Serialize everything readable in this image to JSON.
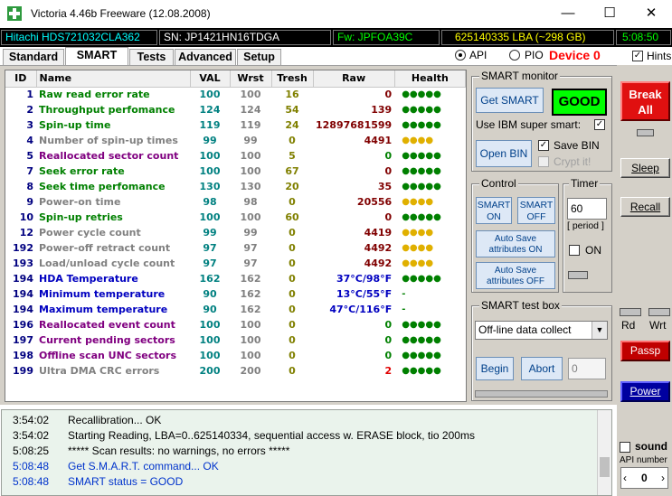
{
  "window": {
    "title": "Victoria 4.46b Freeware (12.08.2008)",
    "minimize": "—",
    "maximize": "☐",
    "close": "✕"
  },
  "drive": {
    "model": "Hitachi HDS721032CLA362",
    "serial": "SN: JP1421HN16TDGA",
    "firmware": "Fw: JPFOA39C",
    "lba": "625140335 LBA (~298 GB)",
    "time": "5:08:50"
  },
  "tabs": [
    {
      "label": "Standard"
    },
    {
      "label": "SMART"
    },
    {
      "label": "Tests"
    },
    {
      "label": "Advanced"
    },
    {
      "label": "Setup"
    }
  ],
  "mode": {
    "api_label": "API",
    "pio_label": "PIO",
    "device_label": "Device 0",
    "hints_label": "Hints"
  },
  "table": {
    "headers": [
      "ID",
      "Name",
      "VAL",
      "Wrst",
      "Tresh",
      "Raw",
      "Health"
    ],
    "rows": [
      {
        "id": "1",
        "name": "Raw read error rate",
        "val": "100",
        "wrst": "100",
        "tresh": "16",
        "raw": "0",
        "health": "●●●●●",
        "name_color": "#008000",
        "raw_color": "#800000",
        "health_color": "#008000"
      },
      {
        "id": "2",
        "name": "Throughput perfomance",
        "val": "124",
        "wrst": "124",
        "tresh": "54",
        "raw": "139",
        "health": "●●●●●",
        "name_color": "#008000",
        "raw_color": "#800000",
        "health_color": "#008000"
      },
      {
        "id": "3",
        "name": "Spin-up time",
        "val": "119",
        "wrst": "119",
        "tresh": "24",
        "raw": "12897681599",
        "health": "●●●●●",
        "name_color": "#008000",
        "raw_color": "#800000",
        "health_color": "#008000"
      },
      {
        "id": "4",
        "name": "Number of spin-up times",
        "val": "99",
        "wrst": "99",
        "tresh": "0",
        "raw": "4491",
        "health": "●●●●",
        "name_color": "#808080",
        "raw_color": "#800000",
        "health_color": "#e0b000"
      },
      {
        "id": "5",
        "name": "Reallocated sector count",
        "val": "100",
        "wrst": "100",
        "tresh": "5",
        "raw": "0",
        "health": "●●●●●",
        "name_color": "#800080",
        "raw_color": "#008000",
        "health_color": "#008000"
      },
      {
        "id": "7",
        "name": "Seek error rate",
        "val": "100",
        "wrst": "100",
        "tresh": "67",
        "raw": "0",
        "health": "●●●●●",
        "name_color": "#008000",
        "raw_color": "#800000",
        "health_color": "#008000"
      },
      {
        "id": "8",
        "name": "Seek time perfomance",
        "val": "130",
        "wrst": "130",
        "tresh": "20",
        "raw": "35",
        "health": "●●●●●",
        "name_color": "#008000",
        "raw_color": "#800000",
        "health_color": "#008000"
      },
      {
        "id": "9",
        "name": "Power-on time",
        "val": "98",
        "wrst": "98",
        "tresh": "0",
        "raw": "20556",
        "health": "●●●●",
        "name_color": "#808080",
        "raw_color": "#800000",
        "health_color": "#e0b000"
      },
      {
        "id": "10",
        "name": "Spin-up retries",
        "val": "100",
        "wrst": "100",
        "tresh": "60",
        "raw": "0",
        "health": "●●●●●",
        "name_color": "#008000",
        "raw_color": "#800000",
        "health_color": "#008000"
      },
      {
        "id": "12",
        "name": "Power cycle count",
        "val": "99",
        "wrst": "99",
        "tresh": "0",
        "raw": "4419",
        "health": "●●●●",
        "name_color": "#808080",
        "raw_color": "#800000",
        "health_color": "#e0b000"
      },
      {
        "id": "192",
        "name": "Power-off retract count",
        "val": "97",
        "wrst": "97",
        "tresh": "0",
        "raw": "4492",
        "health": "●●●●",
        "name_color": "#808080",
        "raw_color": "#800000",
        "health_color": "#e0b000"
      },
      {
        "id": "193",
        "name": "Load/unload cycle count",
        "val": "97",
        "wrst": "97",
        "tresh": "0",
        "raw": "4492",
        "health": "●●●●",
        "name_color": "#808080",
        "raw_color": "#800000",
        "health_color": "#e0b000"
      },
      {
        "id": "194",
        "name": "HDA Temperature",
        "val": "162",
        "wrst": "162",
        "tresh": "0",
        "raw": "37°C/98°F",
        "health": "●●●●●",
        "name_color": "#0000c0",
        "raw_color": "#0000c0",
        "health_color": "#008000"
      },
      {
        "id": "194",
        "name": "Minimum temperature",
        "val": "90",
        "wrst": "162",
        "tresh": "0",
        "raw": "13°C/55°F",
        "health": "-",
        "name_color": "#0000c0",
        "raw_color": "#0000c0",
        "health_color": "#008000"
      },
      {
        "id": "194",
        "name": "Maximum temperature",
        "val": "90",
        "wrst": "162",
        "tresh": "0",
        "raw": "47°C/116°F",
        "health": "-",
        "name_color": "#0000c0",
        "raw_color": "#0000c0",
        "health_color": "#008000"
      },
      {
        "id": "196",
        "name": "Reallocated event count",
        "val": "100",
        "wrst": "100",
        "tresh": "0",
        "raw": "0",
        "health": "●●●●●",
        "name_color": "#800080",
        "raw_color": "#008000",
        "health_color": "#008000"
      },
      {
        "id": "197",
        "name": "Current pending sectors",
        "val": "100",
        "wrst": "100",
        "tresh": "0",
        "raw": "0",
        "health": "●●●●●",
        "name_color": "#800080",
        "raw_color": "#008000",
        "health_color": "#008000"
      },
      {
        "id": "198",
        "name": "Offline scan UNC sectors",
        "val": "100",
        "wrst": "100",
        "tresh": "0",
        "raw": "0",
        "health": "●●●●●",
        "name_color": "#800080",
        "raw_color": "#008000",
        "health_color": "#008000"
      },
      {
        "id": "199",
        "name": "Ultra DMA CRC errors",
        "val": "200",
        "wrst": "200",
        "tresh": "0",
        "raw": "2",
        "health": "●●●●●",
        "name_color": "#808080",
        "raw_color": "#e00000",
        "health_color": "#008000"
      }
    ]
  },
  "smart_monitor": {
    "title": "SMART monitor",
    "get_smart": "Get SMART",
    "status": "GOOD",
    "ibm_label": "Use IBM super smart:",
    "open_bin": "Open BIN",
    "save_bin": "Save BIN",
    "crypt_it": "Crypt it!"
  },
  "control": {
    "title": "Control",
    "smart_on": "SMART ON",
    "smart_off": "SMART OFF",
    "autosave_on": "Auto Save attributes ON",
    "autosave_off": "Auto Save attributes OFF"
  },
  "timer": {
    "title": "Timer",
    "value": "60",
    "period_label": "[ period ]",
    "on_label": "ON"
  },
  "test_box": {
    "title": "SMART test box",
    "selected": "Off-line data collect",
    "begin": "Begin",
    "abort": "Abort",
    "value": "0"
  },
  "right": {
    "break_all": "Break All",
    "sleep": "Sleep",
    "recall": "Recall",
    "rd": "Rd",
    "wrt": "Wrt",
    "passp": "Passp",
    "power": "Power",
    "sound": "sound",
    "api_number": "API number",
    "api_value": "0"
  },
  "log": [
    {
      "time": "3:54:02",
      "msg": "Recallibration... OK",
      "color": "#000000"
    },
    {
      "time": "3:54:02",
      "msg": "Starting Reading, LBA=0..625140334, sequential access w. ERASE block, tio 200ms",
      "color": "#000000"
    },
    {
      "time": "5:08:25",
      "msg": "***** Scan results: no warnings, no errors *****",
      "color": "#000000"
    },
    {
      "time": "5:08:48",
      "msg": "Get S.M.A.R.T. command... OK",
      "color": "#0033cc"
    },
    {
      "time": "5:08:48",
      "msg": "SMART status = GOOD",
      "color": "#0033cc"
    }
  ]
}
